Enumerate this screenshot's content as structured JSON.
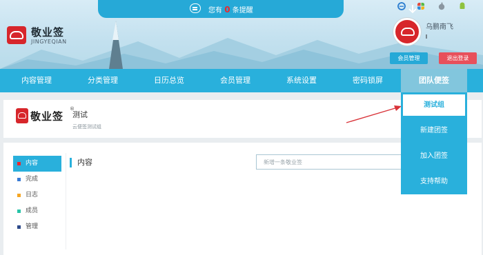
{
  "header": {
    "logo_title": "敬业签",
    "logo_sub": "JINGYEQIAN",
    "notice": {
      "prefix": "您有",
      "count": "0",
      "suffix": "条提醒"
    },
    "username": "乌鹏南飞",
    "member_btn": "会员管理",
    "logout_btn": "退出登录",
    "system_icons": [
      "ie-icon",
      "windows-icon",
      "apple-icon",
      "android-icon"
    ]
  },
  "nav": {
    "items": [
      "内容管理",
      "分类管理",
      "日历总览",
      "会员管理",
      "系统设置",
      "密码锁屏",
      "团队便签"
    ],
    "active_index": 6
  },
  "dropdown": {
    "items": [
      "测试组",
      "新建团签",
      "加入团签",
      "支持帮助"
    ],
    "active_index": 0
  },
  "profile": {
    "logo_name": "敬业签",
    "reg_mark": "®",
    "title": "测试",
    "desc": "云便签测试组"
  },
  "sidebar": {
    "items": [
      {
        "label": "内容",
        "color": "#e8292f"
      },
      {
        "label": "完成",
        "color": "#3a7bd5"
      },
      {
        "label": "日志",
        "color": "#f5a623"
      },
      {
        "label": "成员",
        "color": "#28c4a8"
      },
      {
        "label": "管理",
        "color": "#2d4a8a"
      }
    ],
    "active_index": 0
  },
  "content": {
    "section_title": "内容",
    "search_placeholder": "新增一条敬业签"
  },
  "colors": {
    "accent": "#29b0dc",
    "brand_red": "#d7262b",
    "logout": "#e8505b"
  }
}
